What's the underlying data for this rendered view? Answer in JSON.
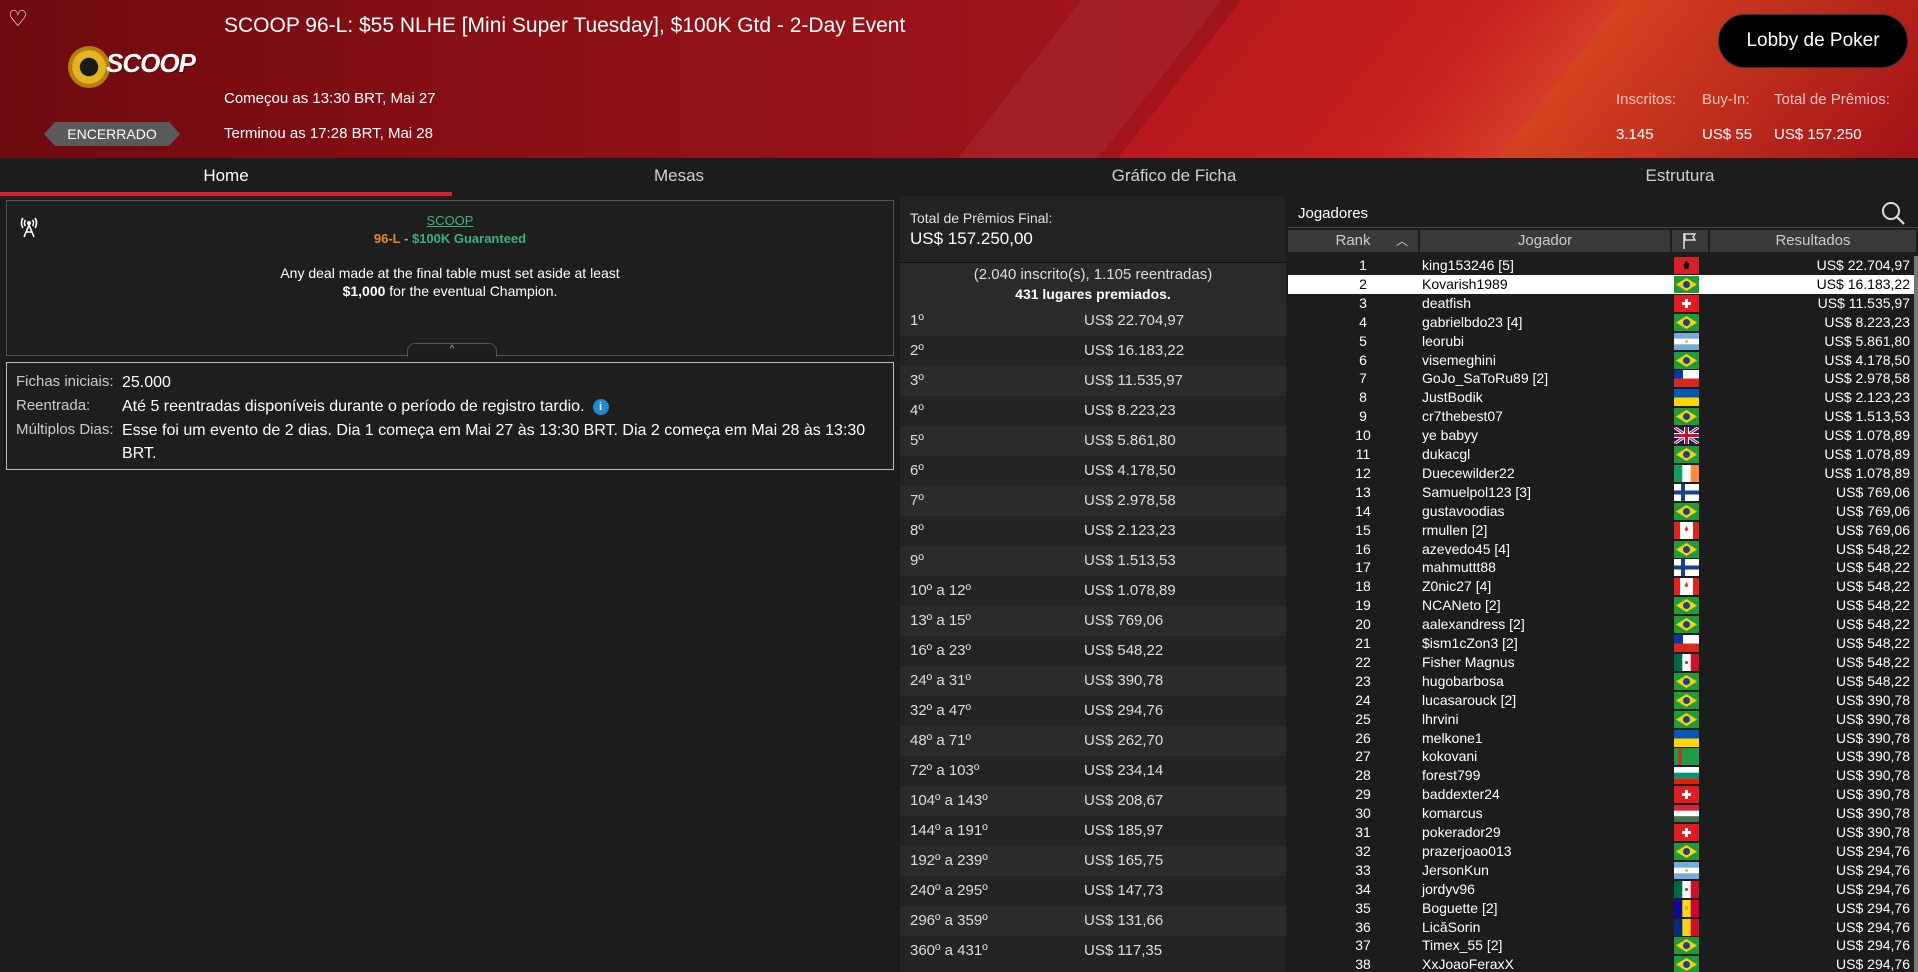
{
  "header": {
    "title": "SCOOP 96-L: $55 NLHE [Mini Super Tuesday], $100K Gtd - 2-Day Event",
    "logo_text": "SCOOP",
    "status": "ENCERRADO",
    "started": "Começou as 13:30 BRT, Mai 27",
    "ended": "Terminou as 17:28 BRT, Mai 28",
    "lobby_button": "Lobby de Poker",
    "stats": {
      "entrants_label": "Inscritos:",
      "entrants": "3.145",
      "buyin_label": "Buy-In:",
      "buyin": "US$ 55",
      "prize_label": "Total de Prêmios:",
      "prize": "US$ 157.250"
    }
  },
  "tabs": [
    {
      "label": "Home",
      "active": true
    },
    {
      "label": "Mesas"
    },
    {
      "label": "Gráfico de Ficha"
    },
    {
      "label": "Estrutura"
    }
  ],
  "info": {
    "brand": "SCOOP",
    "code": "96-L",
    "sep": " - ",
    "guarantee": "$100K Guaranteed",
    "line1": "Any deal made at the final table must set aside at least",
    "line2_bold": "$1,000",
    "line2_rest": " for the eventual Champion."
  },
  "details": {
    "chips_label": "Fichas iniciais:",
    "chips": "25.000",
    "reentry_label": "Reentrada:",
    "reentry": "Até 5 reentradas disponíveis durante o período de registro tardio.",
    "multi_label": "Múltiplos Dias:",
    "multi": "Esse foi um evento de 2 dias. Dia 1 começa em Mai 27 às 13:30 BRT. Dia 2 começa em Mai 28 às 13:30 BRT."
  },
  "prizes": {
    "total_label": "Total de Prêmios Final:",
    "total": "US$ 157.250,00",
    "entries": "(2.040 inscrito(s), 1.105 reentradas)",
    "paid": "431 lugares premiados.",
    "rows": [
      [
        "1º",
        "US$ 22.704,97"
      ],
      [
        "2º",
        "US$ 16.183,22"
      ],
      [
        "3º",
        "US$ 11.535,97"
      ],
      [
        "4º",
        "US$ 8.223,23"
      ],
      [
        "5º",
        "US$ 5.861,80"
      ],
      [
        "6º",
        "US$ 4.178,50"
      ],
      [
        "7º",
        "US$ 2.978,58"
      ],
      [
        "8º",
        "US$ 2.123,23"
      ],
      [
        "9º",
        "US$ 1.513,53"
      ],
      [
        "10º a 12º",
        "US$ 1.078,89"
      ],
      [
        "13º a 15º",
        "US$ 769,06"
      ],
      [
        "16º a 23º",
        "US$ 548,22"
      ],
      [
        "24º a 31º",
        "US$ 390,78"
      ],
      [
        "32º a 47º",
        "US$ 294,76"
      ],
      [
        "48º a 71º",
        "US$ 262,70"
      ],
      [
        "72º a 103º",
        "US$ 234,14"
      ],
      [
        "104º a 143º",
        "US$ 208,67"
      ],
      [
        "144º a 191º",
        "US$ 185,97"
      ],
      [
        "192º a 239º",
        "US$ 165,75"
      ],
      [
        "240º a 295º",
        "US$ 147,73"
      ],
      [
        "296º a 359º",
        "US$ 131,66"
      ],
      [
        "360º a 431º",
        "US$ 117,35"
      ]
    ]
  },
  "players": {
    "title": "Jogadores",
    "col_rank": "Rank",
    "col_player": "Jogador",
    "col_results": "Resultados",
    "rows": [
      [
        1,
        "king153246 [5]",
        "albania",
        "US$ 22.704,97"
      ],
      [
        2,
        "Kovarish1989",
        "brazil",
        "US$ 16.183,22"
      ],
      [
        3,
        "deatfish",
        "swiss",
        "US$ 11.535,97"
      ],
      [
        4,
        "gabrielbdo23 [4]",
        "brazil",
        "US$ 8.223,23"
      ],
      [
        5,
        "leorubi",
        "argentina",
        "US$ 5.861,80"
      ],
      [
        6,
        "visemeghini",
        "brazil",
        "US$ 4.178,50"
      ],
      [
        7,
        "GoJo_SaToRu89 [2]",
        "chile",
        "US$ 2.978,58"
      ],
      [
        8,
        "JustBodik",
        "ukraine",
        "US$ 2.123,23"
      ],
      [
        9,
        "cr7thebest07",
        "brazil",
        "US$ 1.513,53"
      ],
      [
        10,
        "ye babyy",
        "uk",
        "US$ 1.078,89"
      ],
      [
        11,
        "dukacgl",
        "brazil",
        "US$ 1.078,89"
      ],
      [
        12,
        "Duecewilder22",
        "ireland",
        "US$ 1.078,89"
      ],
      [
        13,
        "Samuelpol123 [3]",
        "finland",
        "US$ 769,06"
      ],
      [
        14,
        "gustavoodias",
        "brazil",
        "US$ 769,06"
      ],
      [
        15,
        "rmullen [2]",
        "canada",
        "US$ 769,06"
      ],
      [
        16,
        "azevedo45 [4]",
        "brazil",
        "US$ 548,22"
      ],
      [
        17,
        "mahmuttt88",
        "finland",
        "US$ 548,22"
      ],
      [
        18,
        "Z0nic27 [4]",
        "canada",
        "US$ 548,22"
      ],
      [
        19,
        "NCANeto [2]",
        "brazil",
        "US$ 548,22"
      ],
      [
        20,
        "aalexandress [2]",
        "brazil",
        "US$ 548,22"
      ],
      [
        21,
        "$ism1cZon3 [2]",
        "chile",
        "US$ 548,22"
      ],
      [
        22,
        "Fisher Magnus",
        "mexico",
        "US$ 548,22"
      ],
      [
        23,
        "hugobarbosa",
        "brazil",
        "US$ 548,22"
      ],
      [
        24,
        "lucasarouck [2]",
        "brazil",
        "US$ 390,78"
      ],
      [
        25,
        "lhrvini",
        "brazil",
        "US$ 390,78"
      ],
      [
        26,
        "melkone1",
        "ukraine",
        "US$ 390,78"
      ],
      [
        27,
        "kokovani",
        "turkmenistan",
        "US$ 390,78"
      ],
      [
        28,
        "forest799",
        "bulgaria",
        "US$ 390,78"
      ],
      [
        29,
        "baddexter24",
        "swiss",
        "US$ 390,78"
      ],
      [
        30,
        "komarcus",
        "hungary",
        "US$ 390,78"
      ],
      [
        31,
        "pokerador29",
        "swiss",
        "US$ 390,78"
      ],
      [
        32,
        "prazerjoao013",
        "brazil",
        "US$ 294,76"
      ],
      [
        33,
        "JersonKun",
        "argentina",
        "US$ 294,76"
      ],
      [
        34,
        "jordyv96",
        "mexico",
        "US$ 294,76"
      ],
      [
        35,
        "Boguette [2]",
        "andorra",
        "US$ 294,76"
      ],
      [
        36,
        "LicăSorin",
        "romania",
        "US$ 294,76"
      ],
      [
        37,
        "Timex_55 [2]",
        "brazil",
        "US$ 294,76"
      ],
      [
        38,
        "XxJoaoFeraxX",
        "brazil",
        "US$ 294,76"
      ]
    ]
  }
}
